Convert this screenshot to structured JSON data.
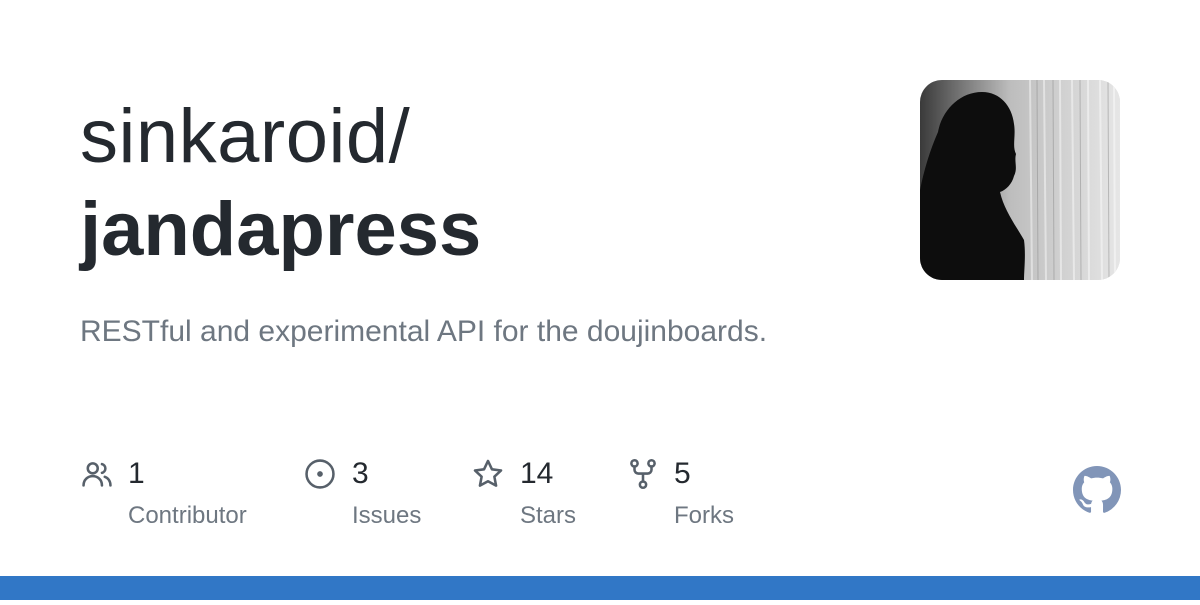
{
  "repo": {
    "owner": "sinkaroid/",
    "name": "jandapress",
    "description": "RESTful and experimental API for the doujinboards."
  },
  "stats": [
    {
      "icon": "people-icon",
      "value": "1",
      "label": "Contributor"
    },
    {
      "icon": "issue-opened-icon",
      "value": "3",
      "label": "Issues"
    },
    {
      "icon": "star-icon",
      "value": "14",
      "label": "Stars"
    },
    {
      "icon": "repo-forked-icon",
      "value": "5",
      "label": "Forks"
    }
  ],
  "avatar": {
    "icon": "owner-avatar"
  },
  "logo": {
    "icon": "github-mark-icon"
  },
  "colors": {
    "text_primary": "#24292f",
    "text_secondary": "#6e7781",
    "icon": "#57606a",
    "logo": "#8195b8",
    "bottom_bar": "#3177c6"
  }
}
